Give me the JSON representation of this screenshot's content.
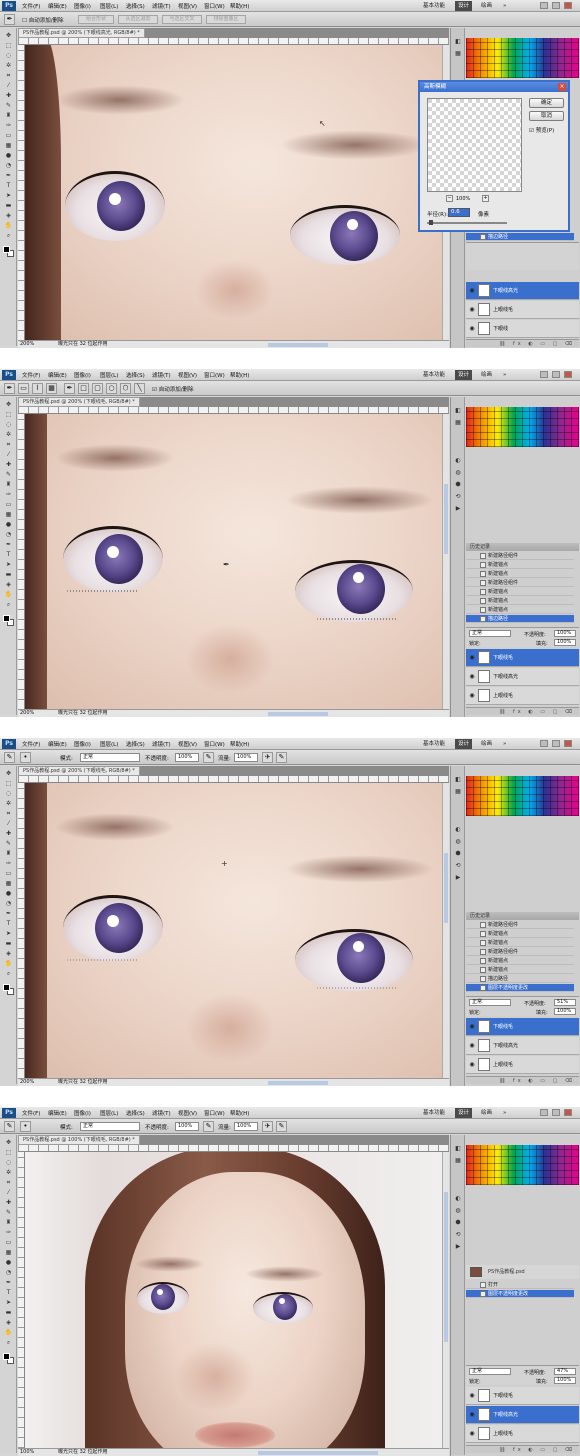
{
  "app": {
    "menus": [
      "文件(F)",
      "编辑(E)",
      "图像(I)",
      "图层(L)",
      "选择(S)",
      "滤镜(T)",
      "视图(V)",
      "窗口(W)",
      "帮助(H)"
    ],
    "workspaces": {
      "basic": "基本功能",
      "design": "设计",
      "painting": "绘画",
      "more": "»"
    }
  },
  "screens": [
    {
      "doc_tab": "PS作品教程.psd @ 200% (下眼线高光, RGB/8#) *",
      "zoom": "200%",
      "status": "曝光只在 32 位起作用",
      "options": {
        "checkbox": "自动添加/删除",
        "disabled_buttons": [
          "组合形状",
          "从选区减去",
          "与选区交叉",
          "排除重叠区"
        ]
      },
      "dialog": {
        "title": "高斯模糊",
        "ok": "确定",
        "cancel": "取消",
        "preview": "预览(P)",
        "zoom_value": "100%",
        "radius_label": "半径(R):",
        "radius_value": "0.6",
        "radius_unit": "像素"
      },
      "history": [
        {
          "label": "描边路径",
          "selected": true
        }
      ],
      "layers": [
        {
          "name": "下眼线高光",
          "selected": true
        },
        {
          "name": "上眼线毛",
          "selected": false
        },
        {
          "name": "下眼线",
          "selected": false
        }
      ]
    },
    {
      "doc_tab": "PS作品教程.psd @ 200% (下眼线毛, RGB/8#) *",
      "zoom": "200%",
      "status": "曝光只在 32 位起作用",
      "options": {
        "checkbox": "自动添加/删除"
      },
      "history_header": "历史记录",
      "history": [
        {
          "label": "新建路径组件",
          "selected": false
        },
        {
          "label": "新建锚点",
          "selected": false
        },
        {
          "label": "新建锚点",
          "selected": false
        },
        {
          "label": "新建路径组件",
          "selected": false
        },
        {
          "label": "新建锚点",
          "selected": false
        },
        {
          "label": "新建锚点",
          "selected": false
        },
        {
          "label": "新建锚点",
          "selected": false
        },
        {
          "label": "描边路径",
          "selected": true
        }
      ],
      "blend_mode": "正常",
      "opacity_label": "不透明度:",
      "opacity": "100%",
      "fill_label": "填充:",
      "fill": "100%",
      "lock_label": "锁定:",
      "layers": [
        {
          "name": "下眼线毛",
          "selected": true
        },
        {
          "name": "下眼线高光",
          "selected": false
        },
        {
          "name": "上眼线毛",
          "selected": false
        }
      ]
    },
    {
      "doc_tab": "PS作品教程.psd @ 200% (下眼线毛, RGB/8#) *",
      "zoom": "200%",
      "status": "曝光只在 32 位起作用",
      "options": {
        "mode_label": "模式:",
        "mode": "正常",
        "opacity_label": "不透明度:",
        "opacity": "100%",
        "flow_label": "流量:",
        "flow": "100%"
      },
      "history_header": "历史记录",
      "history": [
        {
          "label": "新建路径组件",
          "selected": false
        },
        {
          "label": "新建锚点",
          "selected": false
        },
        {
          "label": "新建锚点",
          "selected": false
        },
        {
          "label": "新建路径组件",
          "selected": false
        },
        {
          "label": "新建锚点",
          "selected": false
        },
        {
          "label": "新建锚点",
          "selected": false
        },
        {
          "label": "描边路径",
          "selected": false
        },
        {
          "label": "图层不透明度更改",
          "selected": true
        }
      ],
      "blend_mode": "正常",
      "opacity_label": "不透明度:",
      "opacity": "51%",
      "fill_label": "填充:",
      "fill": "100%",
      "lock_label": "锁定:",
      "layers": [
        {
          "name": "下眼线毛",
          "selected": true
        },
        {
          "name": "下眼线高光",
          "selected": false
        },
        {
          "name": "上眼线毛",
          "selected": false
        }
      ]
    },
    {
      "doc_tab": "PS作品教程.psd @ 100% (下眼线毛, RGB/8#) *",
      "zoom": "100%",
      "status": "曝光只在 32 位起作用",
      "options": {
        "mode_label": "模式:",
        "mode": "正常",
        "opacity_label": "不透明度:",
        "opacity": "100%",
        "flow_label": "流量:",
        "flow": "100%"
      },
      "history_header": "PS作品教程.psd",
      "history": [
        {
          "label": "打开",
          "selected": false
        },
        {
          "label": "图层不透明度更改",
          "selected": true
        }
      ],
      "blend_mode": "正常",
      "opacity_label": "不透明度:",
      "opacity": "47%",
      "fill_label": "填充:",
      "fill": "100%",
      "lock_label": "锁定:",
      "layers": [
        {
          "name": "下眼线毛",
          "selected": false
        },
        {
          "name": "下眼线高光",
          "selected": true
        },
        {
          "name": "上眼线毛",
          "selected": false
        }
      ]
    }
  ]
}
